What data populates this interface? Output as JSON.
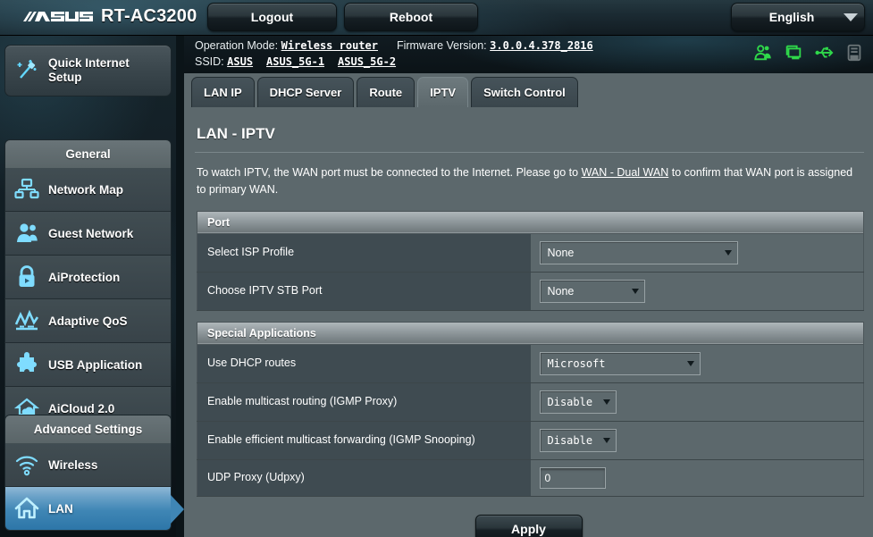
{
  "header": {
    "brand": "ASUS",
    "model": "RT-AC3200",
    "logout_label": "Logout",
    "reboot_label": "Reboot",
    "language": "English",
    "language_caret_icon": "chevron-down-icon"
  },
  "info": {
    "operation_mode_label": "Operation Mode:",
    "operation_mode_value": "Wireless router",
    "firmware_label": "Firmware Version:",
    "firmware_value": "3.0.0.4.378_2816",
    "ssid_label": "SSID:",
    "ssid_values": [
      "ASUS",
      "ASUS_5G-1",
      "ASUS_5G-2"
    ],
    "status_icons": [
      {
        "name": "guest-network-icon",
        "color": "#2fd94a"
      },
      {
        "name": "clients-monitor-icon",
        "color": "#2fd94a"
      },
      {
        "name": "usb-icon",
        "color": "#2fd94a"
      },
      {
        "name": "printer-icon",
        "color": "#6b7578"
      }
    ]
  },
  "sidebar": {
    "quick_setup": {
      "label": "Quick Internet\nSetup",
      "icon": "magic-wand-icon"
    },
    "groups": [
      {
        "title": "General",
        "items": [
          {
            "label": "Network Map",
            "icon": "network-map-icon",
            "active": false
          },
          {
            "label": "Guest Network",
            "icon": "guest-network-icon",
            "active": false
          },
          {
            "label": "AiProtection",
            "icon": "lock-shield-icon",
            "active": false
          },
          {
            "label": "Adaptive QoS",
            "icon": "qos-chart-icon",
            "active": false
          },
          {
            "label": "USB Application",
            "icon": "puzzle-piece-icon",
            "active": false
          },
          {
            "label": "AiCloud 2.0",
            "icon": "cloud-home-icon",
            "active": false
          }
        ]
      },
      {
        "title": "Advanced Settings",
        "items": [
          {
            "label": "Wireless",
            "icon": "wifi-icon",
            "active": false
          },
          {
            "label": "LAN",
            "icon": "home-icon",
            "active": true
          }
        ]
      }
    ]
  },
  "tabs": [
    {
      "label": "LAN IP",
      "active": false
    },
    {
      "label": "DHCP Server",
      "active": false
    },
    {
      "label": "Route",
      "active": false
    },
    {
      "label": "IPTV",
      "active": true
    },
    {
      "label": "Switch Control",
      "active": false
    }
  ],
  "page": {
    "title": "LAN - IPTV",
    "description_part1": "To watch IPTV, the WAN port must be connected to the Internet. Please go to ",
    "description_link": "WAN - Dual WAN",
    "description_part2": " to confirm that WAN port is assigned to primary WAN."
  },
  "sections": [
    {
      "title": "Port",
      "rows": [
        {
          "label": "Select ISP Profile",
          "control": "select",
          "value": "None",
          "width": "w-isp",
          "mono": false
        },
        {
          "label": "Choose IPTV STB Port",
          "control": "select",
          "value": "None",
          "width": "w-stb",
          "mono": false
        }
      ]
    },
    {
      "title": "Special Applications",
      "rows": [
        {
          "label": "Use DHCP routes",
          "control": "select",
          "value": "Microsoft",
          "width": "w-dhcp",
          "mono": true
        },
        {
          "label": "Enable multicast routing (IGMP Proxy)",
          "control": "select",
          "value": "Disable",
          "width": "w-dis",
          "mono": true
        },
        {
          "label": "Enable efficient multicast forwarding (IGMP Snooping)",
          "control": "select",
          "value": "Disable",
          "width": "w-dis",
          "mono": true
        },
        {
          "label": "UDP Proxy (Udpxy)",
          "control": "text",
          "value": "0",
          "width": "",
          "mono": false
        }
      ]
    }
  ],
  "apply_label": "Apply",
  "colors": {
    "accent_blue": "#3f86b5",
    "panel_bg": "#5c686c",
    "label_bg": "#3f4b51",
    "status_green": "#2fd94a"
  }
}
